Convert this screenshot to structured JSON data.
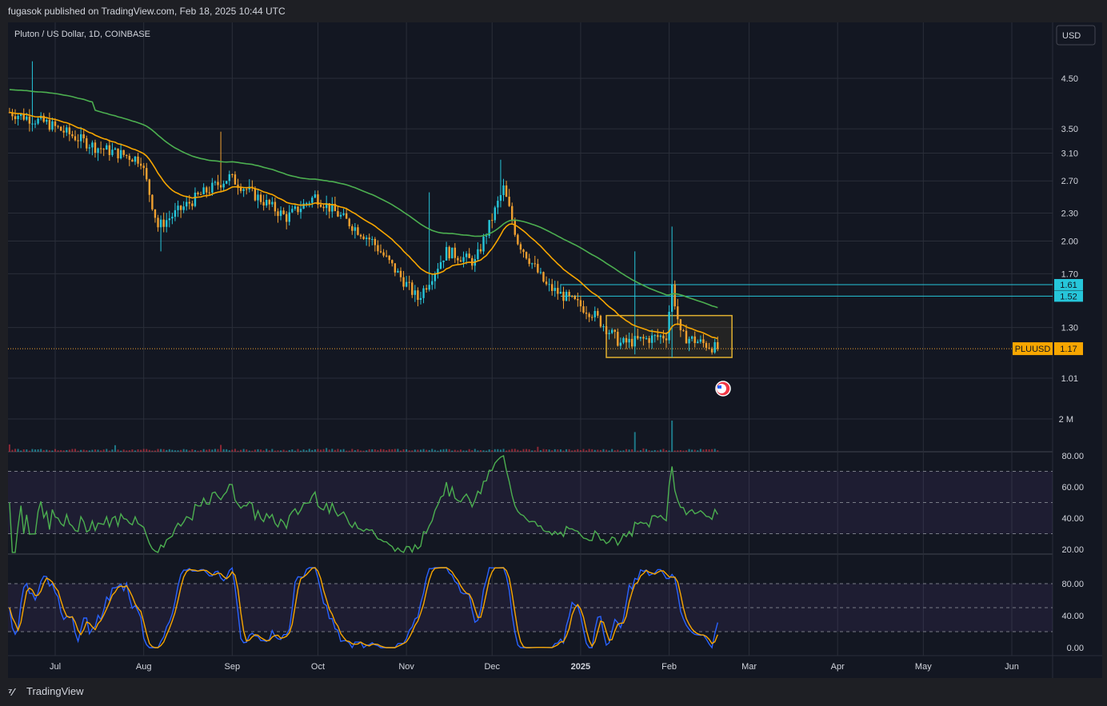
{
  "header": {
    "published_text": "fugasok published on TradingView.com, Feb 18, 2025 10:44 UTC"
  },
  "chart": {
    "symbol_title": "Pluton / US Dollar, 1D, COINBASE",
    "currency_button": "USD",
    "price_labels": [
      "4.50",
      "3.50",
      "3.10",
      "2.70",
      "2.30",
      "2.00",
      "1.70",
      "1.30",
      "1.01"
    ],
    "price_tags": [
      {
        "label": "1.61",
        "color": "#26c6da"
      },
      {
        "label": "1.52",
        "color": "#26c6da"
      }
    ],
    "last_price_ticker": "PLUUSD",
    "last_price": "1.17",
    "volume_label": "2 M",
    "rsi_labels": [
      "80.00",
      "60.00",
      "40.00",
      "20.00"
    ],
    "stoch_labels": [
      "80.00",
      "40.00",
      "0.00"
    ],
    "x_labels": [
      "Jul",
      "Aug",
      "Sep",
      "Oct",
      "Nov",
      "Dec",
      "2025",
      "Feb",
      "Mar",
      "Apr",
      "May",
      "Jun"
    ],
    "colors": {
      "up": "#26c6da",
      "down": "#f0a030",
      "ema_fast": "#f7a600",
      "ema_slow": "#4caf50",
      "rsi": "#4caf50",
      "stoch_k": "#2962ff",
      "stoch_d": "#f7a600",
      "box": "#e0b030"
    }
  },
  "chart_data": {
    "type": "candlestick",
    "title": "Pluton / US Dollar, 1D, COINBASE",
    "x_range": [
      "2024-06-15",
      "2025-06-30"
    ],
    "y_scale": "log",
    "ylim": [
      0.95,
      5.3
    ],
    "key_points": [
      {
        "date": "2024-06-15",
        "close": 3.8
      },
      {
        "date": "2024-06-28",
        "close": 3.6
      },
      {
        "date": "2024-07-15",
        "close": 3.2
      },
      {
        "date": "2024-07-31",
        "close": 3.0
      },
      {
        "date": "2024-08-06",
        "close": 2.15
      },
      {
        "date": "2024-08-20",
        "close": 2.5
      },
      {
        "date": "2024-08-31",
        "close": 2.75
      },
      {
        "date": "2024-09-20",
        "close": 2.25
      },
      {
        "date": "2024-09-30",
        "close": 2.5
      },
      {
        "date": "2024-10-20",
        "close": 2.0
      },
      {
        "date": "2024-11-05",
        "close": 1.5
      },
      {
        "date": "2024-11-15",
        "close": 1.9
      },
      {
        "date": "2024-11-25",
        "close": 1.8
      },
      {
        "date": "2024-12-05",
        "close": 2.6
      },
      {
        "date": "2024-12-10",
        "close": 2.0
      },
      {
        "date": "2024-12-20",
        "close": 1.6
      },
      {
        "date": "2025-01-05",
        "close": 1.4
      },
      {
        "date": "2025-01-15",
        "close": 1.2
      },
      {
        "date": "2025-01-31",
        "close": 1.25
      },
      {
        "date": "2025-02-02",
        "close": 1.6
      },
      {
        "date": "2025-02-05",
        "close": 1.25
      },
      {
        "date": "2025-02-18",
        "close": 1.17
      }
    ],
    "horizontal_levels": [
      1.61,
      1.52
    ],
    "last_price": 1.17,
    "box": {
      "from": "2025-01-10",
      "to": "2025-02-23",
      "low": 1.12,
      "high": 1.38
    },
    "volume": {
      "spikes": [
        {
          "date": "2025-01-20",
          "value": 1200000
        },
        {
          "date": "2025-02-02",
          "value": 1900000
        }
      ]
    },
    "rsi": {
      "levels": [
        70,
        50,
        30
      ],
      "last": 43
    },
    "stoch_rsi": {
      "levels": [
        80,
        50,
        20
      ],
      "last": 20
    }
  }
}
